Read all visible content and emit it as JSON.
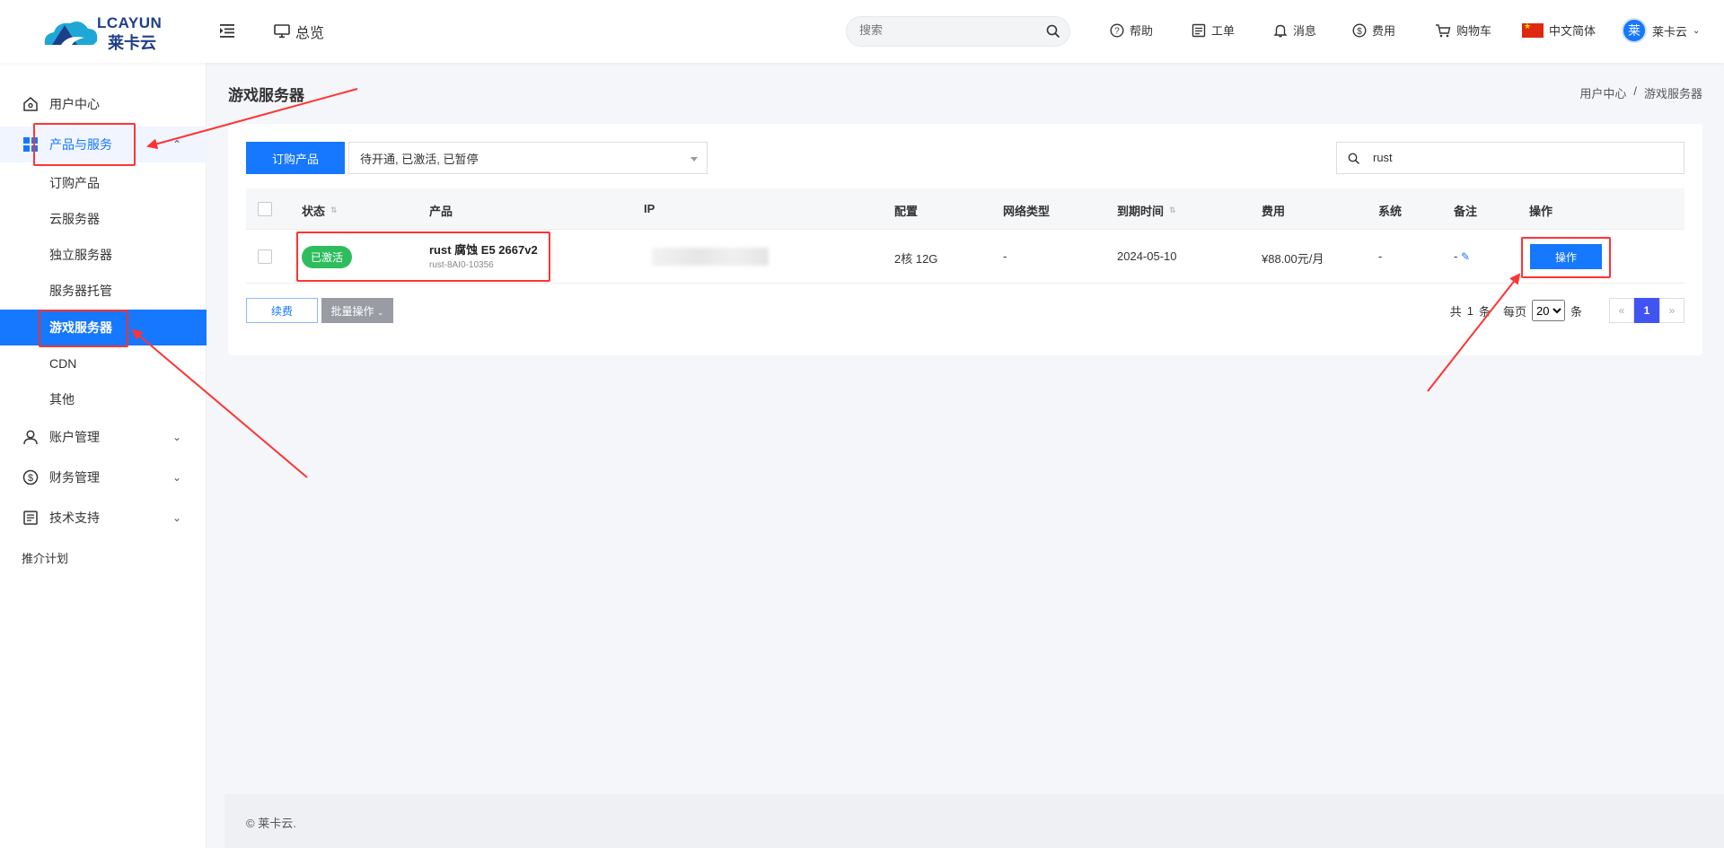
{
  "header": {
    "logo_top": "LCAYUN",
    "logo_bottom": "莱卡云",
    "overview": "总览",
    "search_placeholder": "搜索",
    "nav": [
      {
        "label": "帮助",
        "icon": "help-icon"
      },
      {
        "label": "工单",
        "icon": "ticket-icon"
      },
      {
        "label": "消息",
        "icon": "bell-icon"
      },
      {
        "label": "费用",
        "icon": "dollar-icon"
      },
      {
        "label": "购物车",
        "icon": "cart-icon"
      },
      {
        "label": "中文简体",
        "icon": "cn-flag-icon"
      }
    ],
    "avatar_char": "莱",
    "user": "莱卡云"
  },
  "sidebar": {
    "user_center": "用户中心",
    "products": "产品与服务",
    "sub": [
      "订购产品",
      "云服务器",
      "独立服务器",
      "服务器托管",
      "游戏服务器",
      "CDN",
      "其他"
    ],
    "account": "账户管理",
    "finance": "财务管理",
    "support": "技术支持",
    "referral": "推介计划"
  },
  "main": {
    "title": "游戏服务器",
    "breadcrumb": [
      "用户中心",
      "/",
      "游戏服务器"
    ],
    "order_button": "订购产品",
    "status_filter": "待开通, 已激活, 已暂停",
    "search_value": "rust",
    "columns": [
      "状态",
      "产品",
      "IP",
      "配置",
      "网络类型",
      "到期时间",
      "费用",
      "系统",
      "备注",
      "操作"
    ],
    "row": {
      "status": "已激活",
      "product_name": "rust 腐蚀 E5 2667v2",
      "product_id": "rust-8AI0-10356",
      "config": "2核 12G",
      "network": "-",
      "expire": "2024-05-10",
      "fee": "¥88.00元/月",
      "os": "-",
      "note": "-",
      "action": "操作"
    },
    "renew_button": "续费",
    "batch_button": "批量操作",
    "pager": {
      "total_prefix": "共",
      "total": "1",
      "total_suffix": "条",
      "per_page_label": "每页",
      "per_page": "20",
      "per_page_suffix": "条",
      "prev": "«",
      "current": "1",
      "next": "»"
    }
  },
  "footer": {
    "copyright": "© 莱卡云."
  },
  "colors": {
    "primary": "#1677ff",
    "success": "#2ebd5d",
    "annotation": "#ff3333"
  }
}
